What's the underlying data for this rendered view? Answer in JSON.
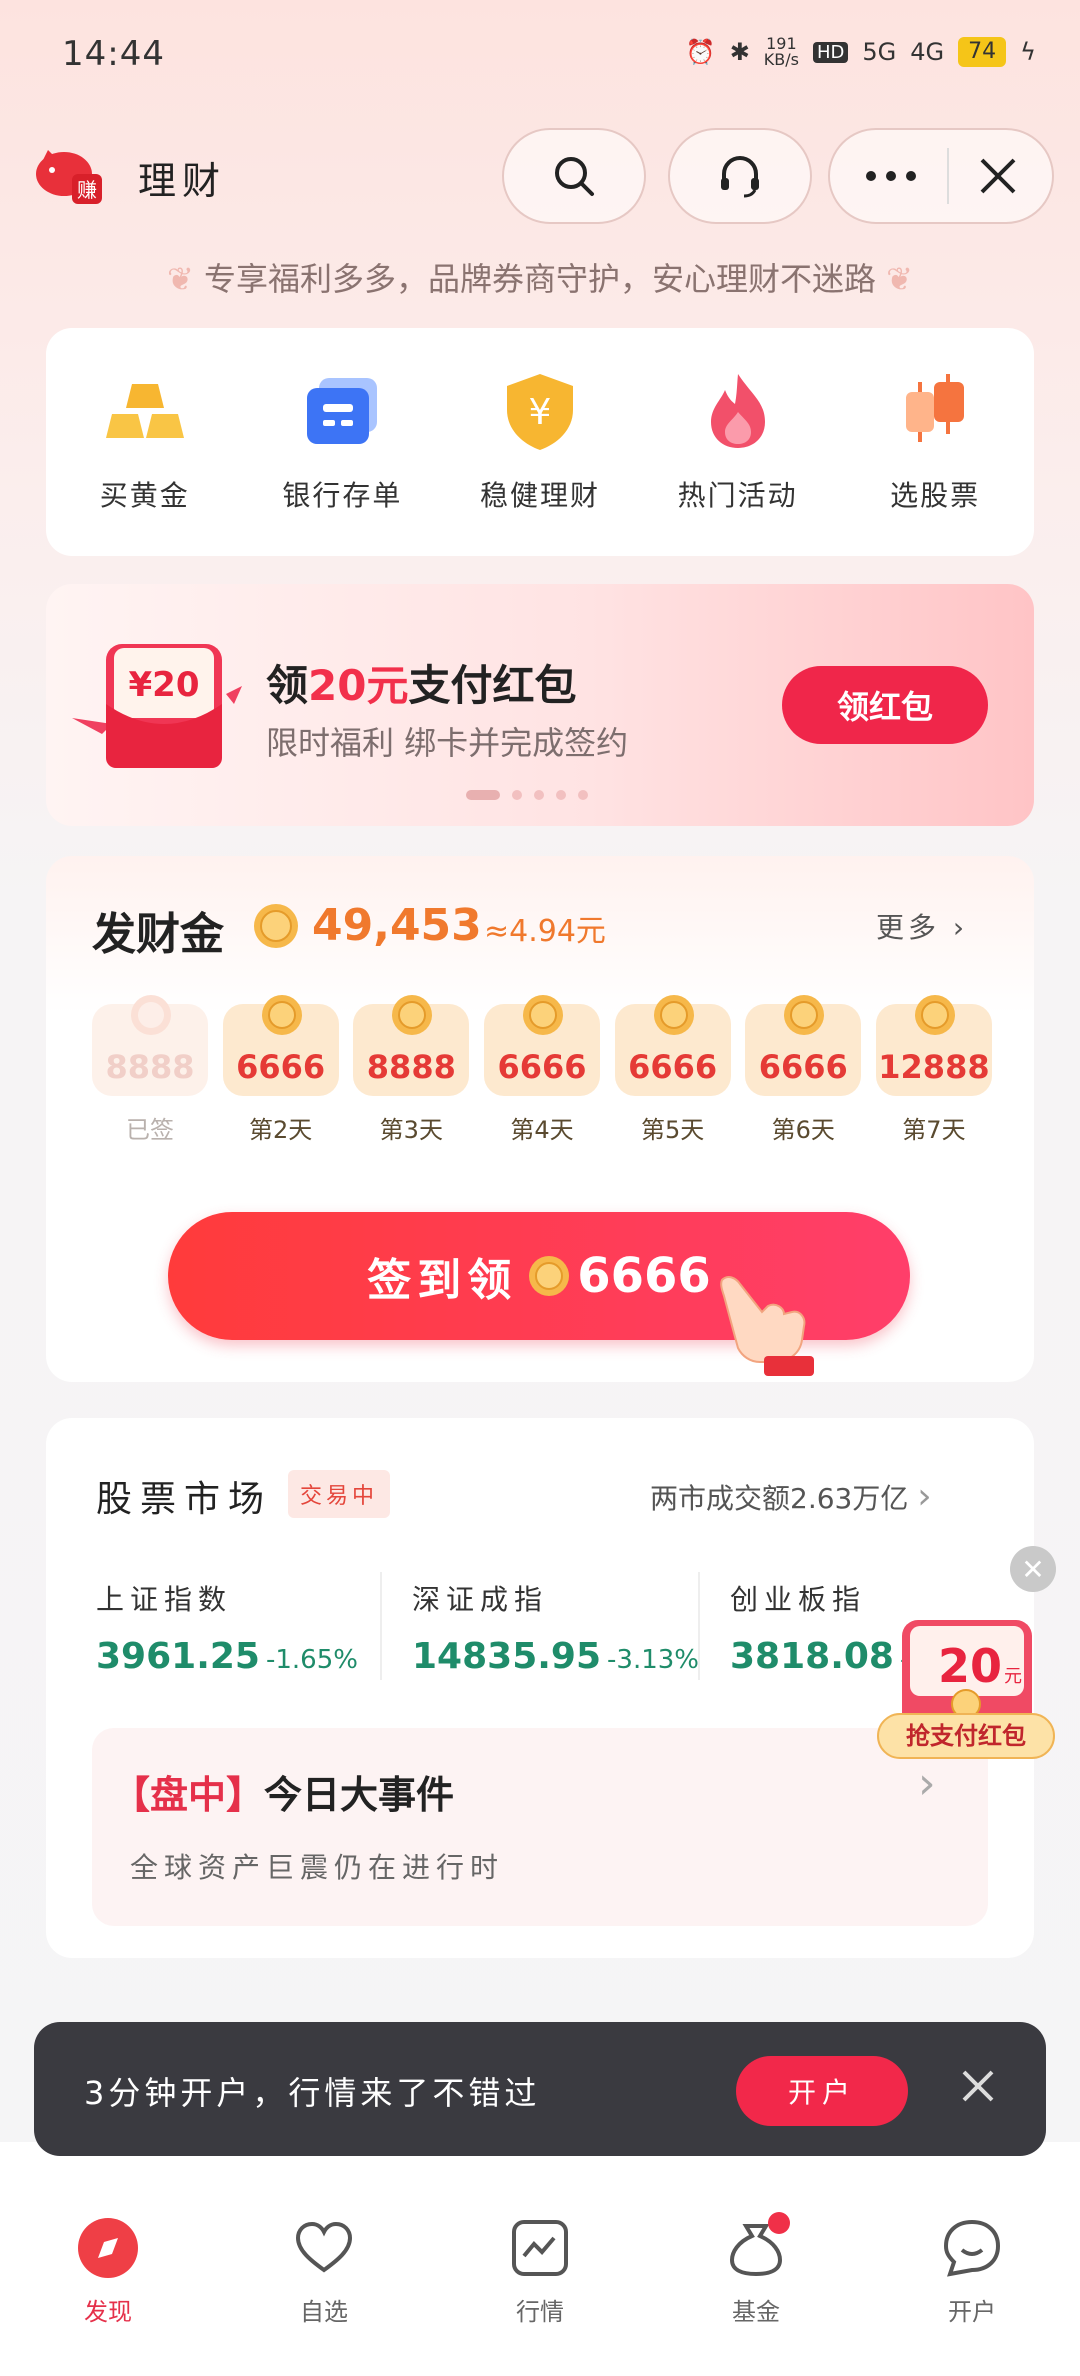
{
  "status": {
    "time": "14:44",
    "net_speed": "191",
    "net_unit": "KB/s",
    "hd": "HD",
    "sig1": "5G",
    "sig2": "4G",
    "battery": "74"
  },
  "header": {
    "title": "理财",
    "logo_text": "赚",
    "subtitle": "专享福利多多，品牌券商守护，安心理财不迷路"
  },
  "quick_links": [
    {
      "label": "买黄金"
    },
    {
      "label": "银行存单"
    },
    {
      "label": "稳健理财"
    },
    {
      "label": "热门活动"
    },
    {
      "label": "选股票"
    }
  ],
  "banner": {
    "packet_value": "¥20",
    "title_pre": "领",
    "title_hl": "20元",
    "title_post": "支付红包",
    "subtitle": "限时福利 绑卡并完成签约",
    "button": "领红包"
  },
  "fortune": {
    "title": "发财金",
    "amount": "49,453",
    "approx": "≈4.94元",
    "more": "更多",
    "days": [
      {
        "value": "8888",
        "label": "已签",
        "signed": true
      },
      {
        "value": "6666",
        "label": "第2天",
        "signed": false
      },
      {
        "value": "8888",
        "label": "第3天",
        "signed": false
      },
      {
        "value": "6666",
        "label": "第4天",
        "signed": false
      },
      {
        "value": "6666",
        "label": "第5天",
        "signed": false
      },
      {
        "value": "6666",
        "label": "第6天",
        "signed": false
      },
      {
        "value": "12888",
        "label": "第7天",
        "signed": false
      }
    ],
    "checkin_text": "签到领",
    "checkin_value": "6666"
  },
  "market": {
    "title": "股票市场",
    "badge": "交易中",
    "volume": "两市成交额2.63万亿",
    "indices": [
      {
        "name": "上证指数",
        "value": "3961.25",
        "change": "-1.65%"
      },
      {
        "name": "深证成指",
        "value": "14835.95",
        "change": "-3.13%"
      },
      {
        "name": "创业板指",
        "value": "3818.08",
        "change": "-3"
      }
    ],
    "event_bracket": "【盘中】",
    "event_title": "今日大事件",
    "event_desc": "全球资产巨震仍在进行时"
  },
  "float_packet": {
    "value": "20",
    "unit": "元",
    "button": "抢支付红包"
  },
  "toast": {
    "text": "3分钟开户，行情来了不错过",
    "button": "开户"
  },
  "nav": [
    {
      "label": "发现",
      "icon": "discover-icon"
    },
    {
      "label": "自选",
      "icon": "heart-icon"
    },
    {
      "label": "行情",
      "icon": "chart-icon"
    },
    {
      "label": "基金",
      "icon": "fund-bag-icon"
    },
    {
      "label": "开户",
      "icon": "chat-icon"
    }
  ],
  "colors": {
    "accent": "#f0264a",
    "gold": "#f0792d",
    "down_green": "#1f8c6a"
  }
}
